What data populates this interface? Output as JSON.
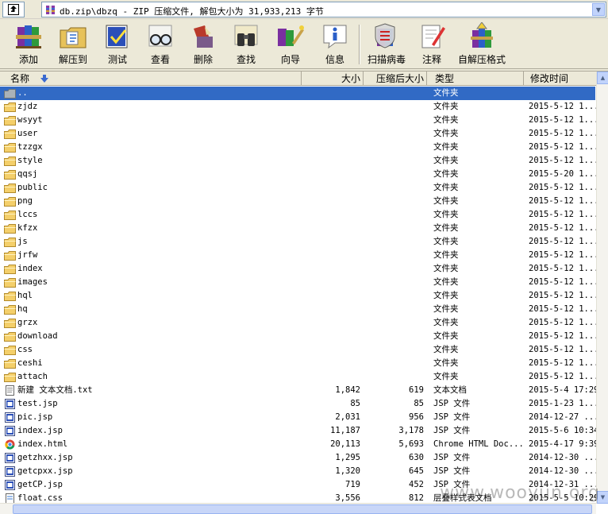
{
  "address": {
    "path": "db.zip\\dbzq - ZIP 压缩文件, 解包大小为 31,933,213 字节"
  },
  "toolbar": {
    "add_label": "添加",
    "extract_label": "解压到",
    "test_label": "测试",
    "view_label": "查看",
    "delete_label": "删除",
    "find_label": "查找",
    "wizard_label": "向导",
    "info_label": "信息",
    "scan_label": "扫描病毒",
    "comment_label": "注释",
    "sfx_label": "自解压格式"
  },
  "columns": {
    "name": "名称",
    "size": "大小",
    "packed": "压缩后大小",
    "type": "类型",
    "modified": "修改时间"
  },
  "rows": [
    {
      "name": "..",
      "size": "",
      "packed": "",
      "type": "文件夹",
      "modified": "",
      "icon": "folder-up-icon"
    },
    {
      "name": "zjdz",
      "size": "",
      "packed": "",
      "type": "文件夹",
      "modified": "2015-5-12 1...",
      "icon": "folder-icon"
    },
    {
      "name": "wsyyt",
      "size": "",
      "packed": "",
      "type": "文件夹",
      "modified": "2015-5-12 1...",
      "icon": "folder-icon"
    },
    {
      "name": "user",
      "size": "",
      "packed": "",
      "type": "文件夹",
      "modified": "2015-5-12 1...",
      "icon": "folder-icon"
    },
    {
      "name": "tzzgx",
      "size": "",
      "packed": "",
      "type": "文件夹",
      "modified": "2015-5-12 1...",
      "icon": "folder-icon"
    },
    {
      "name": "style",
      "size": "",
      "packed": "",
      "type": "文件夹",
      "modified": "2015-5-12 1...",
      "icon": "folder-icon"
    },
    {
      "name": "qqsj",
      "size": "",
      "packed": "",
      "type": "文件夹",
      "modified": "2015-5-20 1...",
      "icon": "folder-icon"
    },
    {
      "name": "public",
      "size": "",
      "packed": "",
      "type": "文件夹",
      "modified": "2015-5-12 1...",
      "icon": "folder-icon"
    },
    {
      "name": "png",
      "size": "",
      "packed": "",
      "type": "文件夹",
      "modified": "2015-5-12 1...",
      "icon": "folder-icon"
    },
    {
      "name": "lccs",
      "size": "",
      "packed": "",
      "type": "文件夹",
      "modified": "2015-5-12 1...",
      "icon": "folder-icon"
    },
    {
      "name": "kfzx",
      "size": "",
      "packed": "",
      "type": "文件夹",
      "modified": "2015-5-12 1...",
      "icon": "folder-icon"
    },
    {
      "name": "js",
      "size": "",
      "packed": "",
      "type": "文件夹",
      "modified": "2015-5-12 1...",
      "icon": "folder-icon"
    },
    {
      "name": "jrfw",
      "size": "",
      "packed": "",
      "type": "文件夹",
      "modified": "2015-5-12 1...",
      "icon": "folder-icon"
    },
    {
      "name": "index",
      "size": "",
      "packed": "",
      "type": "文件夹",
      "modified": "2015-5-12 1...",
      "icon": "folder-icon"
    },
    {
      "name": "images",
      "size": "",
      "packed": "",
      "type": "文件夹",
      "modified": "2015-5-12 1...",
      "icon": "folder-icon"
    },
    {
      "name": "hql",
      "size": "",
      "packed": "",
      "type": "文件夹",
      "modified": "2015-5-12 1...",
      "icon": "folder-icon"
    },
    {
      "name": "hq",
      "size": "",
      "packed": "",
      "type": "文件夹",
      "modified": "2015-5-12 1...",
      "icon": "folder-icon"
    },
    {
      "name": "grzx",
      "size": "",
      "packed": "",
      "type": "文件夹",
      "modified": "2015-5-12 1...",
      "icon": "folder-icon"
    },
    {
      "name": "download",
      "size": "",
      "packed": "",
      "type": "文件夹",
      "modified": "2015-5-12 1...",
      "icon": "folder-icon"
    },
    {
      "name": "css",
      "size": "",
      "packed": "",
      "type": "文件夹",
      "modified": "2015-5-12 1...",
      "icon": "folder-icon"
    },
    {
      "name": "ceshi",
      "size": "",
      "packed": "",
      "type": "文件夹",
      "modified": "2015-5-12 1...",
      "icon": "folder-icon"
    },
    {
      "name": "attach",
      "size": "",
      "packed": "",
      "type": "文件夹",
      "modified": "2015-5-12 1...",
      "icon": "folder-icon"
    },
    {
      "name": "新建 文本文档.txt",
      "size": "1,842",
      "packed": "619",
      "type": "文本文档",
      "modified": "2015-5-4 17:29",
      "icon": "text-file-icon"
    },
    {
      "name": "test.jsp",
      "size": "85",
      "packed": "85",
      "type": "JSP 文件",
      "modified": "2015-1-23 1...",
      "icon": "jsp-file-icon"
    },
    {
      "name": "pic.jsp",
      "size": "2,031",
      "packed": "956",
      "type": "JSP 文件",
      "modified": "2014-12-27 ...",
      "icon": "jsp-file-icon"
    },
    {
      "name": "index.jsp",
      "size": "11,187",
      "packed": "3,178",
      "type": "JSP 文件",
      "modified": "2015-5-6 10:34",
      "icon": "jsp-file-icon"
    },
    {
      "name": "index.html",
      "size": "20,113",
      "packed": "5,693",
      "type": "Chrome HTML Doc...",
      "modified": "2015-4-17 9:39",
      "icon": "chrome-html-icon"
    },
    {
      "name": "getzhxx.jsp",
      "size": "1,295",
      "packed": "630",
      "type": "JSP 文件",
      "modified": "2014-12-30 ...",
      "icon": "jsp-file-icon"
    },
    {
      "name": "getcpxx.jsp",
      "size": "1,320",
      "packed": "645",
      "type": "JSP 文件",
      "modified": "2014-12-30 ...",
      "icon": "jsp-file-icon"
    },
    {
      "name": "getCP.jsp",
      "size": "719",
      "packed": "452",
      "type": "JSP 文件",
      "modified": "2014-12-31 ...",
      "icon": "jsp-file-icon"
    },
    {
      "name": "float.css",
      "size": "3,556",
      "packed": "812",
      "type": "层叠样式表文档",
      "modified": "2015-5-5 10:29",
      "icon": "css-file-icon"
    }
  ],
  "watermark": "www.wooyun.org",
  "colors": {
    "selection": "#316ac5",
    "chrome": "#ece9d8",
    "folder": "#f4cf6a"
  }
}
